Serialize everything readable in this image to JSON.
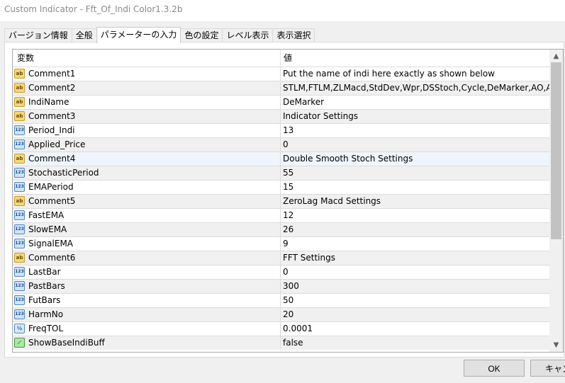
{
  "window": {
    "title": "Custom Indicator - Fft_Of_Indi Color1.3.2b"
  },
  "tabs": [
    {
      "label": "バージョン情報"
    },
    {
      "label": "全般"
    },
    {
      "label": "パラメーターの入力"
    },
    {
      "label": "色の設定"
    },
    {
      "label": "レベル表示"
    },
    {
      "label": "表示選択"
    }
  ],
  "active_tab": "パラメーターの入力",
  "table": {
    "headers": {
      "variable": "変数",
      "value": "値"
    },
    "rows": [
      {
        "icon": "ab-string-icon",
        "name": "Comment1",
        "value": "Put the name of indi here exactly as shown below"
      },
      {
        "icon": "ab-string-icon",
        "name": "Comment2",
        "value": "STLM,FTLM,ZLMacd,StdDev,Wpr,DSStoch,Cycle,DeMarker,AO,AC"
      },
      {
        "icon": "ab-string-icon",
        "name": "IndiName",
        "value": "DeMarker"
      },
      {
        "icon": "ab-string-icon",
        "name": "Comment3",
        "value": "Indicator Settings"
      },
      {
        "icon": "123-integer-icon",
        "name": "Period_Indi",
        "value": "13"
      },
      {
        "icon": "123-integer-icon",
        "name": "Applied_Price",
        "value": "0"
      },
      {
        "icon": "ab-string-icon",
        "name": "Comment4",
        "value": "Double Smooth Stoch Settings"
      },
      {
        "icon": "123-integer-icon",
        "name": "StochasticPeriod",
        "value": "55"
      },
      {
        "icon": "123-integer-icon",
        "name": "EMAPeriod",
        "value": "15"
      },
      {
        "icon": "ab-string-icon",
        "name": "Comment5",
        "value": "ZeroLag Macd Settings"
      },
      {
        "icon": "123-integer-icon",
        "name": "FastEMA",
        "value": "12"
      },
      {
        "icon": "123-integer-icon",
        "name": "SlowEMA",
        "value": "26"
      },
      {
        "icon": "123-integer-icon",
        "name": "SignalEMA",
        "value": "9"
      },
      {
        "icon": "ab-string-icon",
        "name": "Comment6",
        "value": "FFT Settings"
      },
      {
        "icon": "123-integer-icon",
        "name": "LastBar",
        "value": "0"
      },
      {
        "icon": "123-integer-icon",
        "name": "PastBars",
        "value": "300"
      },
      {
        "icon": "123-integer-icon",
        "name": "FutBars",
        "value": "50"
      },
      {
        "icon": "123-integer-icon",
        "name": "HarmNo",
        "value": "20"
      },
      {
        "icon": "fraction-double-icon",
        "name": "FreqTOL",
        "value": "0.0001"
      },
      {
        "icon": "bool-chart-icon",
        "name": "ShowBaseIndiBuff",
        "value": "false"
      }
    ]
  },
  "icons": {
    "ab-string-icon": "ab",
    "123-integer-icon": "123",
    "fraction-double-icon": "½",
    "bool-chart-icon": "⟋"
  },
  "scrollbar": {
    "up_icon": "chevron-up-icon",
    "down_icon": "chevron-down-icon"
  },
  "buttons": {
    "ok": "OK",
    "cancel": "キャンセル"
  }
}
